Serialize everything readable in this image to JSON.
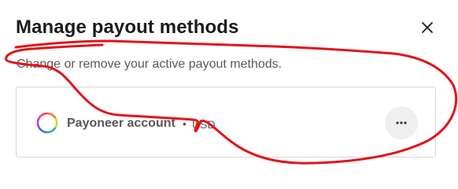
{
  "dialog": {
    "title": "Manage payout methods",
    "subtitle": "Change or remove your active payout methods.",
    "close_icon": "close-icon"
  },
  "payout_methods": [
    {
      "name": "Payoneer account",
      "separator": "•",
      "currency": "USD",
      "logo_icon": "payoneer-logo-icon",
      "actions_icon": "more-horizontal-icon"
    }
  ],
  "annotation": {
    "color": "#e0151b",
    "type": "freehand-scribble"
  },
  "colors": {
    "title_text": "#1c1c1c",
    "secondary_text": "#595959",
    "card_border": "#d6d6d6",
    "menu_button_bg": "#efefef"
  }
}
